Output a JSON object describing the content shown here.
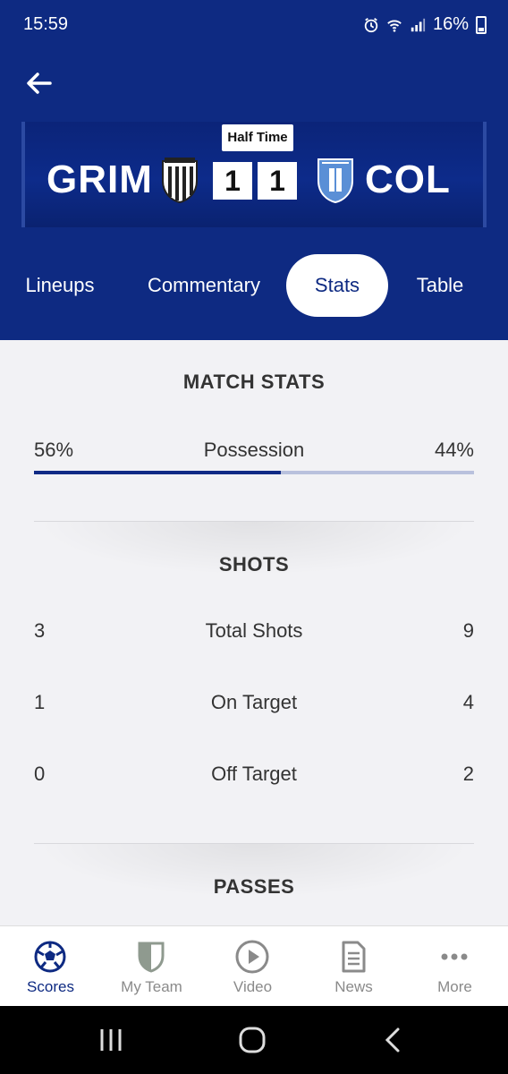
{
  "status_bar": {
    "time": "15:59",
    "battery": "16%"
  },
  "match": {
    "status": "Half Time",
    "home": {
      "abbr": "GRIM",
      "score": "1"
    },
    "away": {
      "abbr": "COL",
      "score": "1"
    }
  },
  "tabs": [
    {
      "label": "Lineups"
    },
    {
      "label": "Commentary"
    },
    {
      "label": "Stats",
      "active": true
    },
    {
      "label": "Table"
    }
  ],
  "match_stats": {
    "title": "MATCH STATS",
    "possession": {
      "label": "Possession",
      "home": "56%",
      "away": "44%",
      "home_fraction": 0.56
    }
  },
  "shots": {
    "title": "SHOTS",
    "rows": [
      {
        "home": "3",
        "label": "Total Shots",
        "away": "9"
      },
      {
        "home": "1",
        "label": "On Target",
        "away": "4"
      },
      {
        "home": "0",
        "label": "Off Target",
        "away": "2"
      }
    ]
  },
  "passes": {
    "title": "PASSES"
  },
  "bottom_nav": [
    {
      "label": "Scores",
      "icon": "football-icon",
      "active": true
    },
    {
      "label": "My Team",
      "icon": "shield-icon"
    },
    {
      "label": "Video",
      "icon": "play-icon"
    },
    {
      "label": "News",
      "icon": "document-icon"
    },
    {
      "label": "More",
      "icon": "more-icon"
    }
  ],
  "colors": {
    "brand_blue": "#0e2a82",
    "bar_track": "#b9c1dd"
  }
}
